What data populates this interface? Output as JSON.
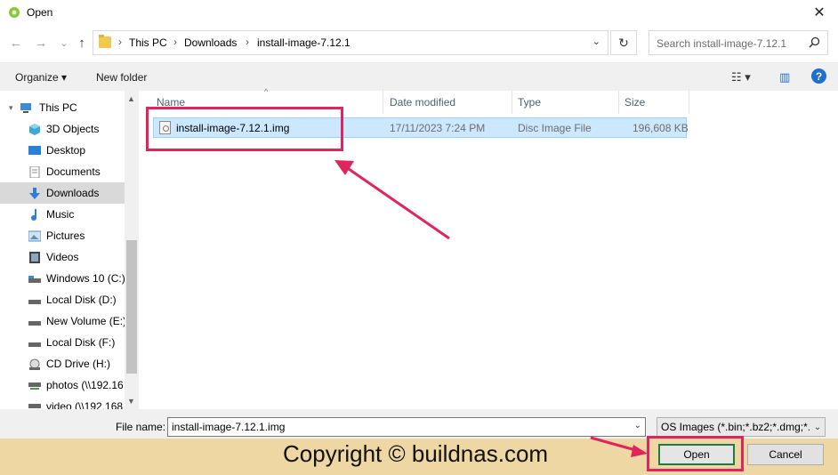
{
  "window": {
    "title": "Open",
    "close_glyph": "✕"
  },
  "nav_buttons": {
    "back": "←",
    "forward": "→",
    "recent": "⌄",
    "up": "↑"
  },
  "address": {
    "breadcrumbs": [
      "This PC",
      "Downloads",
      "install-image-7.12.1"
    ],
    "separator": "›",
    "dropdown_glyph": "⌄",
    "refresh_glyph": "↻"
  },
  "search": {
    "placeholder": "Search install-image-7.12.1",
    "icon": "search-icon"
  },
  "toolbar": {
    "organize_label": "Organize ▾",
    "new_folder_label": "New folder",
    "view_glyph": "☷ ▾",
    "pane_glyph": "▥",
    "help_glyph": "?"
  },
  "nav_pane": {
    "items": [
      {
        "label": "This PC",
        "icon": "computer-icon",
        "color": "#3d8ad6"
      },
      {
        "label": "3D Objects",
        "icon": "cube-icon",
        "color": "#3aa9d8"
      },
      {
        "label": "Desktop",
        "icon": "desktop-icon",
        "color": "#2b7fd6"
      },
      {
        "label": "Documents",
        "icon": "document-icon",
        "color": "#8a8a8a"
      },
      {
        "label": "Downloads",
        "icon": "download-icon",
        "color": "#2b7fd6",
        "selected": true
      },
      {
        "label": "Music",
        "icon": "music-icon",
        "color": "#2b7fd6"
      },
      {
        "label": "Pictures",
        "icon": "pictures-icon",
        "color": "#5a8fbf"
      },
      {
        "label": "Videos",
        "icon": "videos-icon",
        "color": "#555555"
      },
      {
        "label": "Windows 10 (C:)",
        "icon": "drive-icon",
        "color": "#555555"
      },
      {
        "label": "Local Disk (D:)",
        "icon": "drive-icon",
        "color": "#555555"
      },
      {
        "label": "New Volume (E:)",
        "icon": "drive-icon",
        "color": "#555555"
      },
      {
        "label": "Local Disk (F:)",
        "icon": "drive-icon",
        "color": "#555555"
      },
      {
        "label": "CD Drive (H:)",
        "icon": "cd-drive-icon",
        "color": "#777777"
      },
      {
        "label": "photos (\\\\192.16",
        "icon": "network-drive-icon",
        "color": "#4a9a4a"
      },
      {
        "label": "video (\\\\192.168",
        "icon": "network-drive-icon",
        "color": "#4a9a4a"
      }
    ],
    "scroll_up": "▲",
    "scroll_down": "▼"
  },
  "columns": {
    "name": "Name",
    "date": "Date modified",
    "type": "Type",
    "size": "Size",
    "sort_glyph": "^"
  },
  "files": [
    {
      "name": "install-image-7.12.1.img",
      "date": "17/11/2023 7:24 PM",
      "type": "Disc Image File",
      "size": "196,608 KB",
      "selected": true
    }
  ],
  "footer": {
    "file_name_label": "File name:",
    "file_name_value": "install-image-7.12.1.img",
    "file_type_value": "OS Images (*.bin;*.bz2;*.dmg;*.",
    "dropdown_glyph": "⌄",
    "open_label": "Open",
    "cancel_label": "Cancel",
    "copyright": "Copyright © buildnas.com"
  },
  "colors": {
    "annotation": "#e0245e",
    "selection": "#cce8ff",
    "watermark_band": "#efd7a4"
  }
}
